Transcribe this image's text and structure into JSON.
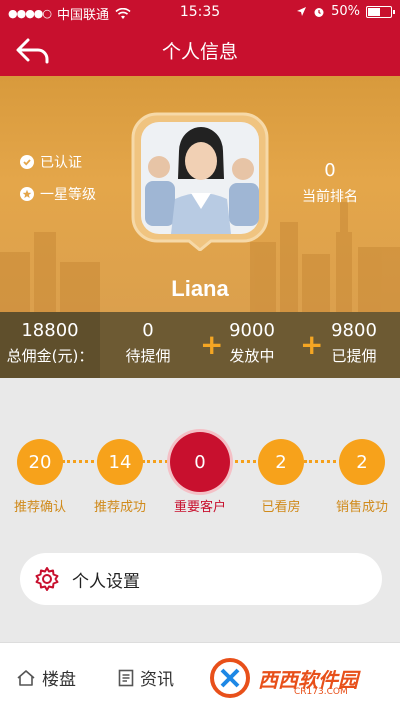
{
  "status_bar": {
    "carrier": "中国联通",
    "time": "15:35",
    "battery": "50%",
    "battery_level": 0.5
  },
  "nav": {
    "title": "个人信息"
  },
  "profile": {
    "verified_label": "已认证",
    "level_label": "一星等级",
    "rank_value": "0",
    "rank_label": "当前排名",
    "username": "Liana"
  },
  "stats": [
    {
      "value": "18800",
      "label": "总佣金(元)："
    },
    {
      "value": "0",
      "label": "待提佣"
    },
    {
      "value": "9000",
      "label": "发放中"
    },
    {
      "value": "9800",
      "label": "已提佣"
    }
  ],
  "plus_symbol": "+",
  "steps": [
    {
      "value": "20",
      "label": "推荐确认"
    },
    {
      "value": "14",
      "label": "推荐成功"
    },
    {
      "value": "0",
      "label": "重要客户"
    },
    {
      "value": "2",
      "label": "已看房"
    },
    {
      "value": "2",
      "label": "销售成功"
    }
  ],
  "settings": {
    "label": "个人设置"
  },
  "tabs": [
    {
      "label": "楼盘",
      "icon": "home-icon"
    },
    {
      "label": "资讯",
      "icon": "news-icon"
    }
  ],
  "watermark": {
    "text": "西西软件园",
    "sub": "CR173.COM"
  },
  "colors": {
    "primary": "#c8102e",
    "accent": "#f7a21b",
    "gold": "#e4a64a"
  }
}
